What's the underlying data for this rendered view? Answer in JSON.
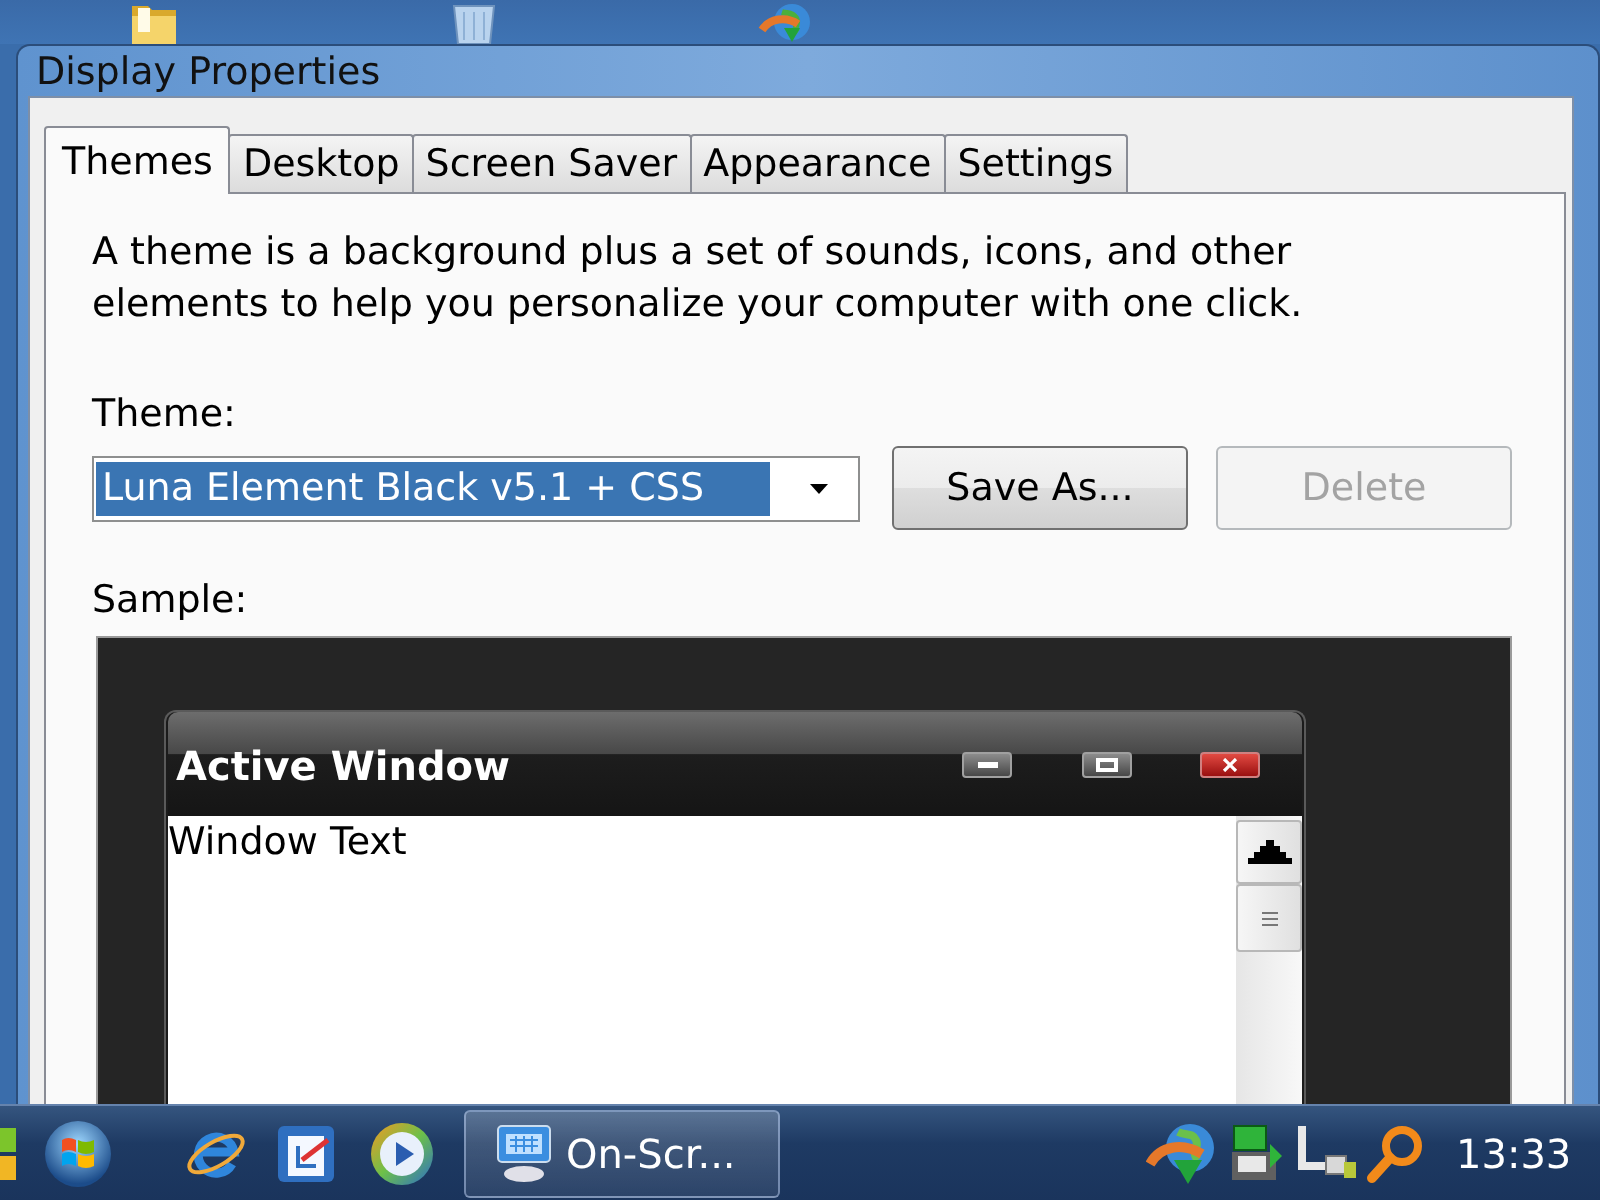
{
  "window": {
    "title": "Display Properties"
  },
  "tabs": [
    {
      "label": "Themes",
      "selected": true
    },
    {
      "label": "Desktop",
      "selected": false
    },
    {
      "label": "Screen Saver",
      "selected": false
    },
    {
      "label": "Appearance",
      "selected": false
    },
    {
      "label": "Settings",
      "selected": false
    }
  ],
  "themes_page": {
    "description": "A theme is a background plus a set of sounds, icons, and other elements to help you personalize your computer with one click.",
    "theme_label": "Theme:",
    "theme_select": {
      "value": "Luna Element Black v5.1 + CSS",
      "focused": true
    },
    "buttons": [
      {
        "label": "Save As...",
        "disabled": false
      },
      {
        "label": "Delete",
        "disabled": true
      }
    ],
    "sample_label": "Sample:",
    "sample": {
      "window_title": "Active Window",
      "window_text": "Window Text"
    }
  },
  "taskbar": {
    "tasks": [
      {
        "label": "On-Scr...",
        "selected": false
      }
    ],
    "clock": "13:33"
  }
}
